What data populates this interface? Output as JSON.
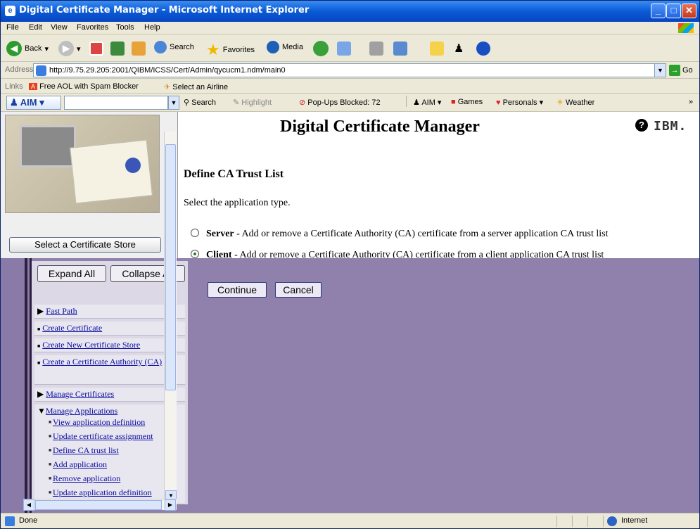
{
  "window": {
    "title": "Digital Certificate Manager - Microsoft Internet Explorer"
  },
  "menu": [
    "File",
    "Edit",
    "View",
    "Favorites",
    "Tools",
    "Help"
  ],
  "toolbar": {
    "back": "Back",
    "search": "Search",
    "favorites": "Favorites",
    "media": "Media"
  },
  "address": {
    "label": "Address",
    "url": "http://9.75.29.205:2001/QIBM/ICSS/Cert/Admin/qycucm1.ndm/main0",
    "go": "Go"
  },
  "links": {
    "label": "Links",
    "items": [
      "Free AOL with Spam Blocker",
      "Select an Airline"
    ]
  },
  "aim": {
    "button": "AIM",
    "search": "Search",
    "highlight": "Highlight",
    "popups": "Pop-Ups Blocked: 72",
    "aim_menu": "AIM",
    "games": "Games",
    "personals": "Personals",
    "weather": "Weather"
  },
  "page": {
    "header_title": "Digital Certificate Manager",
    "ibm_logo": "IBM.",
    "section_title": "Define CA Trust List",
    "prompt": "Select the application type.",
    "options": [
      {
        "name": "Server",
        "desc": " - Add or remove a Certificate Authority (CA) certificate from a server application CA trust list",
        "selected": false
      },
      {
        "name": "Client",
        "desc": " - Add or remove a Certificate Authority (CA) certificate from a client application CA trust list",
        "selected": true
      }
    ],
    "continue": "Continue",
    "cancel": "Cancel"
  },
  "nav": {
    "select_store": "Select a Certificate Store",
    "expand_all": "Expand All",
    "collapse_all": "Collapse All",
    "items": [
      "Fast Path",
      "Create Certificate",
      "Create New Certificate Store",
      "Create a Certificate Authority (CA)",
      "Manage Certificates",
      "Manage Applications"
    ],
    "sub_items": [
      "View application definition",
      "Update certificate assignment",
      "Define CA trust list",
      "Add application",
      "Remove application",
      "Update application definition"
    ]
  },
  "status": {
    "text": "Done",
    "zone": "Internet"
  }
}
